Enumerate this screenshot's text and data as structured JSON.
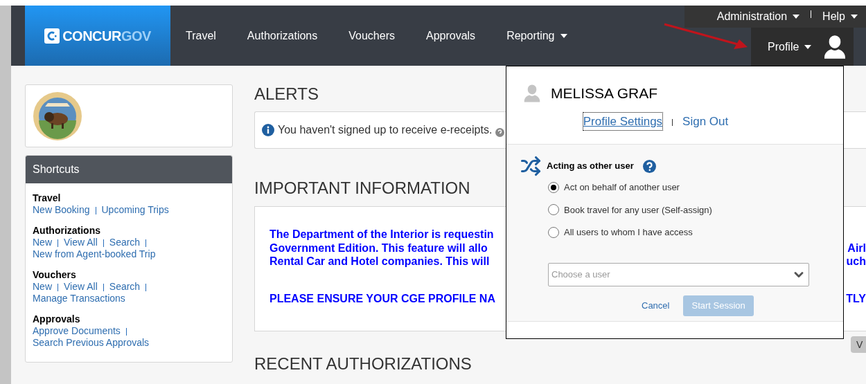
{
  "nav": {
    "logo": {
      "prefix": "CONCUR",
      "suffix": "GOV"
    },
    "items": [
      {
        "label": "Travel",
        "dropdown": false
      },
      {
        "label": "Authorizations",
        "dropdown": false
      },
      {
        "label": "Vouchers",
        "dropdown": false
      },
      {
        "label": "Approvals",
        "dropdown": false
      },
      {
        "label": "Reporting",
        "dropdown": true
      }
    ],
    "top_links": [
      {
        "label": "Administration",
        "dropdown": true
      },
      {
        "label": "Help",
        "dropdown": true
      }
    ],
    "profile": {
      "label": "Profile",
      "expanded": true
    }
  },
  "shortcuts": {
    "title": "Shortcuts",
    "groups": [
      {
        "title": "Travel",
        "links": [
          "New Booking",
          "Upcoming Trips"
        ]
      },
      {
        "title": "Authorizations",
        "links": [
          "New",
          "View All",
          "Search",
          "New from Agent-booked Trip"
        ]
      },
      {
        "title": "Vouchers",
        "links": [
          "New",
          "View All",
          "Search",
          "Manage Transactions"
        ]
      },
      {
        "title": "Approvals",
        "links": [
          "Approve Documents",
          "Search Previous Approvals"
        ]
      }
    ]
  },
  "alerts": {
    "title": "ALERTS",
    "message": "You haven't signed up to receive e-receipts."
  },
  "important": {
    "title": "IMPORTANT INFORMATION",
    "lines": [
      {
        "text": "The Department of the Interior is requestin"
      },
      {
        "text": "Government Edition.  This feature will allo",
        "right": "Airl"
      },
      {
        "text": "Rental Car and Hotel companies.  This will",
        "right": "uch"
      },
      {
        "text": "PLEASE ENSURE YOUR CGE PROFILE NA",
        "right": "TLY"
      }
    ]
  },
  "side_button": "V",
  "recent": {
    "title": "RECENT AUTHORIZATIONS"
  },
  "profile_menu": {
    "name": "MELISSA GRAF",
    "links": [
      "Profile Settings",
      "Sign Out"
    ],
    "acting": {
      "title": "Acting as other user",
      "options": [
        {
          "label": "Act on behalf of another user",
          "selected": true
        },
        {
          "label": "Book travel for any user (Self-assign)",
          "selected": false
        },
        {
          "label": "All users to whom I have access",
          "selected": false
        }
      ],
      "select_placeholder": "Choose a user",
      "cancel": "Cancel",
      "start": {
        "label": "Start Session",
        "disabled": true
      }
    }
  }
}
